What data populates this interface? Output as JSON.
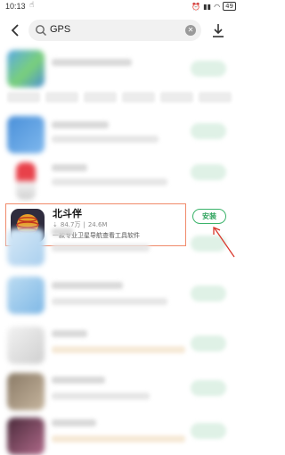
{
  "status_bar": {
    "time": "10:13",
    "indicators": [
      "bird-icon",
      "alarm-icon",
      "signal-icon",
      "wifi-icon"
    ],
    "battery": "49"
  },
  "search": {
    "value": "GPS"
  },
  "highlighted_app": {
    "name": "北斗伴",
    "downloads": "84.7万",
    "separator": "|",
    "size": "24.6M",
    "description": "一款专业卫星导航查看工具软件",
    "button_label": "安装"
  },
  "colors": {
    "accent_green": "#2ea35c",
    "highlight_border": "#f08a6a",
    "annotation_red": "#d9372b"
  }
}
